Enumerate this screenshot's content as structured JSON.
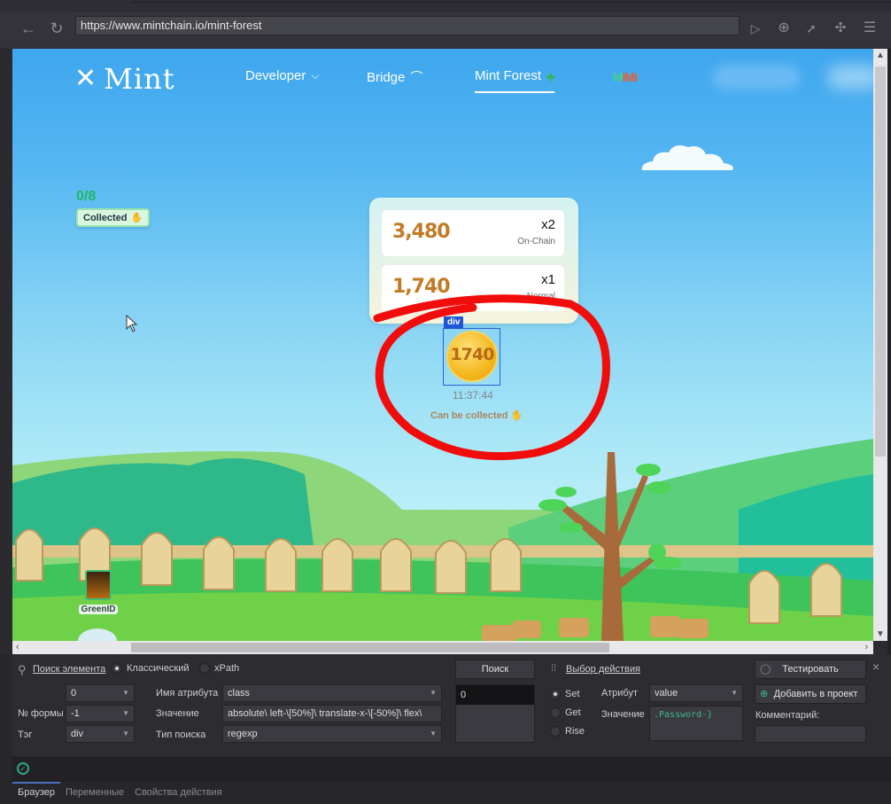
{
  "browser": {
    "url": "https://www.mintchain.io/mint-forest",
    "toolbar_icons": [
      "back-icon",
      "reload-icon",
      "play-icon",
      "target-icon",
      "cursor-icon",
      "extension-icon",
      "menu-icon"
    ]
  },
  "site": {
    "logo_text": "Mint",
    "nav": [
      {
        "label": "Developer",
        "icon": "chevron-down-icon",
        "active": false
      },
      {
        "label": "Bridge",
        "icon": "bridge-icon",
        "active": false
      },
      {
        "label": "Mint Forest",
        "icon": "tree-icon",
        "active": true
      }
    ],
    "mimi_brand": {
      "part1": "M",
      "part2": "iMi"
    },
    "progress": {
      "count": "0/8",
      "badge_label": "Collected"
    },
    "rewards": [
      {
        "amount": "3,480",
        "multiplier": "x2",
        "label": "On-Chain"
      },
      {
        "amount": "1,740",
        "multiplier": "x1",
        "label": "Normal"
      }
    ],
    "coin": {
      "value": "1740",
      "timer": "11:37:44",
      "status": "Can be collected"
    },
    "inspector_tag": "div",
    "green_id_label": "GreenID"
  },
  "panel": {
    "search_element_link": "Поиск элемента",
    "mode_options": [
      {
        "label": "Классический",
        "selected": true
      },
      {
        "label": "xPath",
        "selected": false
      }
    ],
    "index_value": "0",
    "form_number_label": "№ формы",
    "form_number_value": "-1",
    "tag_label": "Тэг",
    "tag_value": "div",
    "attr_name_label": "Имя атрибута",
    "attr_name_value": "class",
    "value_label": "Значение",
    "value_value": "absolute\\ left-\\[50%]\\ translate-x-\\[-50%]\\ flex\\",
    "search_type_label": "Тип поиска",
    "search_type_value": "regexp",
    "search_button": "Поиск",
    "search_result": "0",
    "action_select_link": "Выбор действия",
    "action_options": [
      {
        "label": "Set",
        "selected": true
      },
      {
        "label": "Get",
        "selected": false
      },
      {
        "label": "Rise",
        "selected": false
      }
    ],
    "attribute_label": "Атрибут",
    "attribute_value": "value",
    "action_value_label": "Значение",
    "action_value_text": ".Password-}",
    "test_button": "Тестировать",
    "add_button": "Добавить в проект",
    "comment_label": "Комментарий:",
    "comment_value": "",
    "close_glyph": "×",
    "tabs": [
      {
        "label": "Браузер",
        "active": true
      },
      {
        "label": "Переменные",
        "active": false
      },
      {
        "label": "Свойства действия",
        "active": false
      }
    ]
  }
}
